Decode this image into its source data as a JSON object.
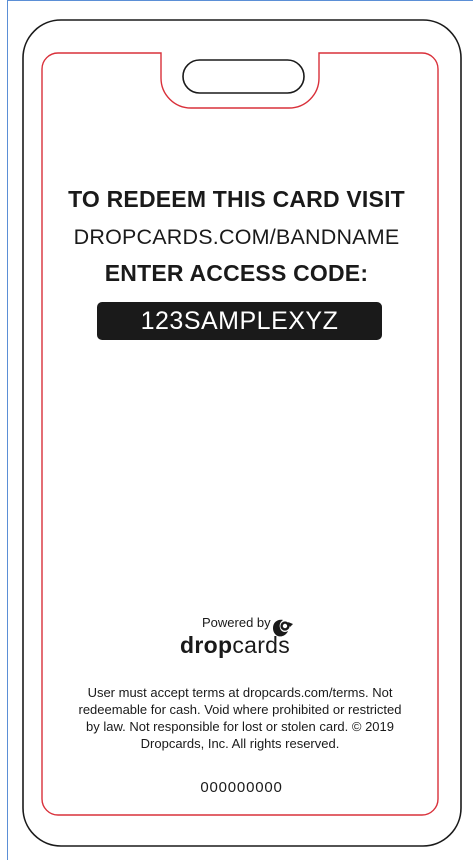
{
  "card": {
    "line1": "TO REDEEM THIS CARD VISIT",
    "line2": "DROPCARDS.COM/BANDNAME",
    "line3": "ENTER ACCESS CODE:",
    "access_code": "123SAMPLEXYZ",
    "powered_by": "Powered by",
    "brand_bold": "drop",
    "brand_light": "cards",
    "terms": "User must accept terms at dropcards.com/terms. Not redeemable for cash. Void where prohibited or restricted by law. Not responsible for lost or stolen card. © 2019 Dropcards, Inc. All rights reserved.",
    "serial": "000000000"
  },
  "colors": {
    "outline": "#1a1a1a",
    "safe_line": "#d9303a",
    "page_edge": "#5b8fd6",
    "code_bg": "#1a1a1a"
  },
  "icons": {
    "logo": "dropcards-logo-icon"
  }
}
